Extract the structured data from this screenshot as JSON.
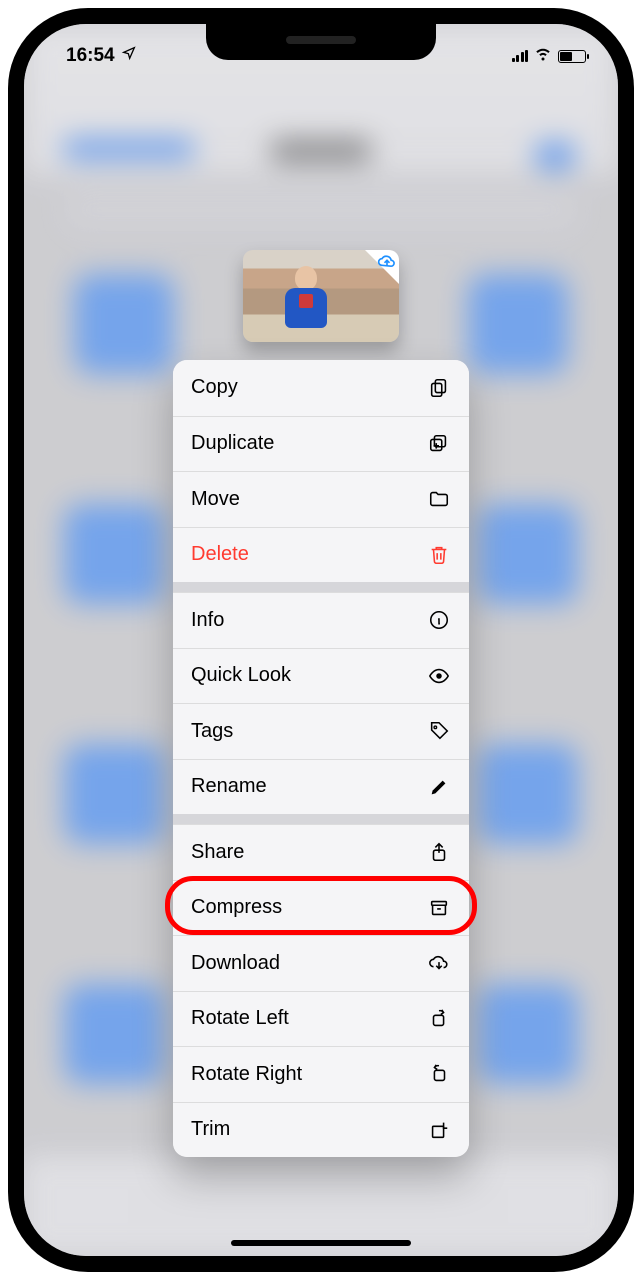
{
  "status": {
    "time": "16:54"
  },
  "menu": {
    "groups": [
      [
        {
          "id": "copy",
          "label": "Copy",
          "icon": "copy-icon"
        },
        {
          "id": "duplicate",
          "label": "Duplicate",
          "icon": "duplicate-icon"
        },
        {
          "id": "move",
          "label": "Move",
          "icon": "folder-icon"
        },
        {
          "id": "delete",
          "label": "Delete",
          "icon": "trash-icon",
          "destructive": true
        }
      ],
      [
        {
          "id": "info",
          "label": "Info",
          "icon": "info-icon"
        },
        {
          "id": "quicklook",
          "label": "Quick Look",
          "icon": "eye-icon"
        },
        {
          "id": "tags",
          "label": "Tags",
          "icon": "tag-icon"
        },
        {
          "id": "rename",
          "label": "Rename",
          "icon": "pencil-icon"
        }
      ],
      [
        {
          "id": "share",
          "label": "Share",
          "icon": "share-icon"
        },
        {
          "id": "compress",
          "label": "Compress",
          "icon": "archive-icon",
          "highlighted": true
        },
        {
          "id": "download",
          "label": "Download",
          "icon": "cloud-download-icon"
        },
        {
          "id": "rotateleft",
          "label": "Rotate Left",
          "icon": "rotate-left-icon"
        },
        {
          "id": "rotateright",
          "label": "Rotate Right",
          "icon": "rotate-right-icon"
        },
        {
          "id": "trim",
          "label": "Trim",
          "icon": "trim-icon"
        }
      ]
    ]
  }
}
